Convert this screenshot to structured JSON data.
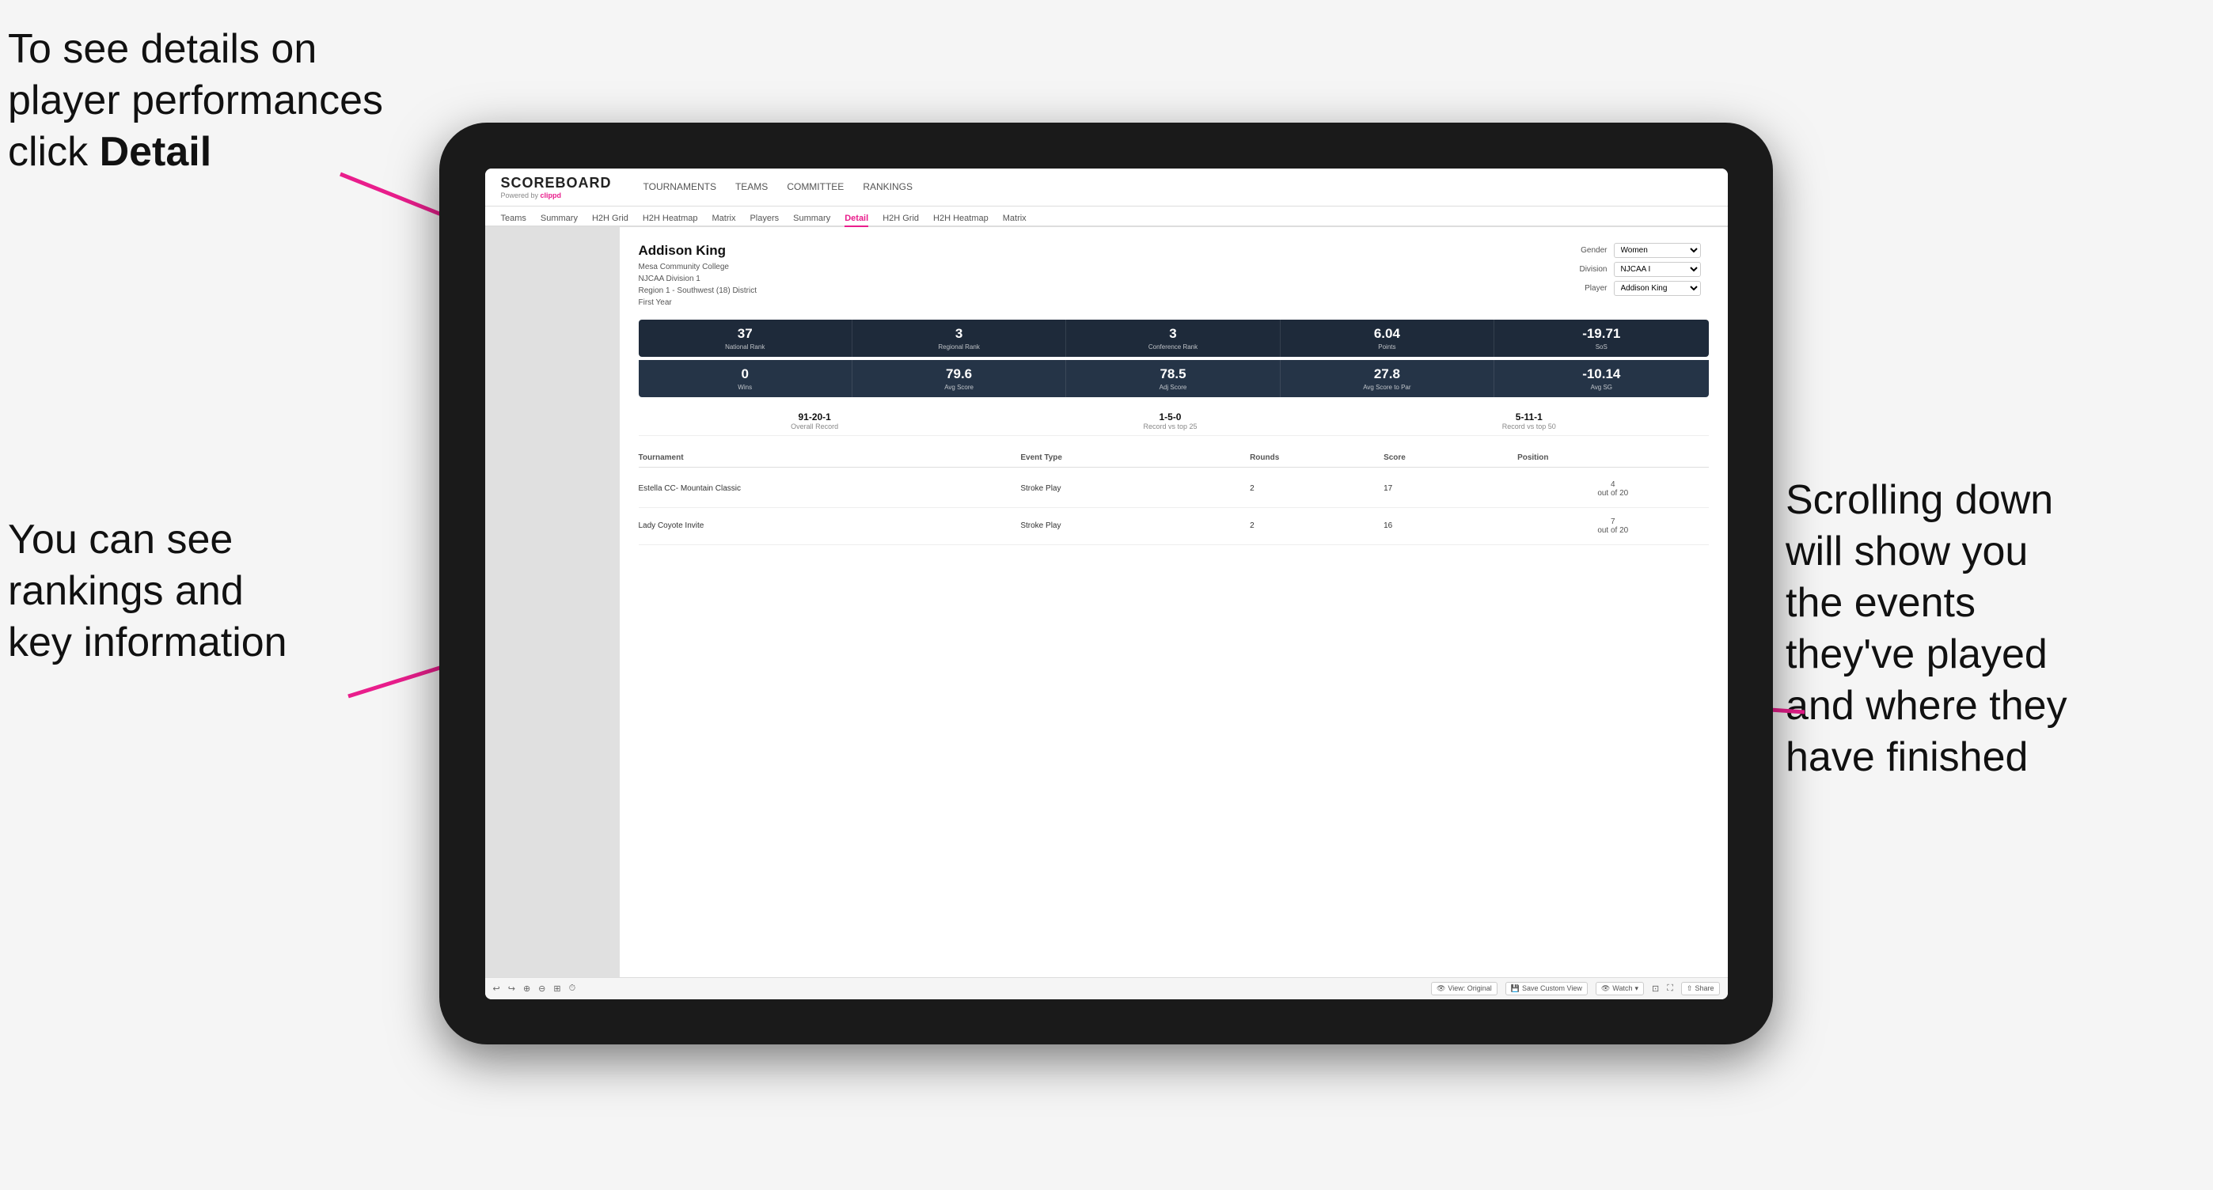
{
  "annotations": {
    "topleft": "To see details on player performances click ",
    "topleft_bold": "Detail",
    "bottomleft_line1": "You can see",
    "bottomleft_line2": "rankings and",
    "bottomleft_line3": "key information",
    "bottomright_line1": "Scrolling down",
    "bottomright_line2": "will show you",
    "bottomright_line3": "the events",
    "bottomright_line4": "they've played",
    "bottomright_line5": "and where they",
    "bottomright_line6": "have finished"
  },
  "nav": {
    "logo": "SCOREBOARD",
    "powered_by": "Powered by",
    "brand": "clippd",
    "items": [
      {
        "label": "TOURNAMENTS",
        "active": false
      },
      {
        "label": "TEAMS",
        "active": false
      },
      {
        "label": "COMMITTEE",
        "active": false
      },
      {
        "label": "RANKINGS",
        "active": false
      }
    ]
  },
  "subnav": {
    "items": [
      {
        "label": "Teams",
        "active": false
      },
      {
        "label": "Summary",
        "active": false
      },
      {
        "label": "H2H Grid",
        "active": false
      },
      {
        "label": "H2H Heatmap",
        "active": false
      },
      {
        "label": "Matrix",
        "active": false
      },
      {
        "label": "Players",
        "active": false
      },
      {
        "label": "Summary",
        "active": false
      },
      {
        "label": "Detail",
        "active": true
      },
      {
        "label": "H2H Grid",
        "active": false
      },
      {
        "label": "H2H Heatmap",
        "active": false
      },
      {
        "label": "Matrix",
        "active": false
      }
    ]
  },
  "player": {
    "name": "Addison King",
    "college": "Mesa Community College",
    "division": "NJCAA Division 1",
    "region": "Region 1 - Southwest (18) District",
    "year": "First Year"
  },
  "filters": {
    "gender_label": "Gender",
    "gender_value": "Women",
    "division_label": "Division",
    "division_value": "NJCAA I",
    "player_label": "Player",
    "player_value": "Addison King"
  },
  "stats_row1": [
    {
      "value": "37",
      "label": "National Rank"
    },
    {
      "value": "3",
      "label": "Regional Rank"
    },
    {
      "value": "3",
      "label": "Conference Rank"
    },
    {
      "value": "6.04",
      "label": "Points"
    },
    {
      "value": "-19.71",
      "label": "SoS"
    }
  ],
  "stats_row2": [
    {
      "value": "0",
      "label": "Wins"
    },
    {
      "value": "79.6",
      "label": "Avg Score"
    },
    {
      "value": "78.5",
      "label": "Adj Score"
    },
    {
      "value": "27.8",
      "label": "Avg Score to Par"
    },
    {
      "value": "-10.14",
      "label": "Avg SG"
    }
  ],
  "records": [
    {
      "value": "91-20-1",
      "label": "Overall Record"
    },
    {
      "value": "1-5-0",
      "label": "Record vs top 25"
    },
    {
      "value": "5-11-1",
      "label": "Record vs top 50"
    }
  ],
  "table": {
    "headers": [
      "Tournament",
      "Event Type",
      "Rounds",
      "Score",
      "Position"
    ],
    "rows": [
      {
        "tournament": "Estella CC- Mountain Classic",
        "event_type": "Stroke Play",
        "rounds": "2",
        "score": "17",
        "position": "4\nout of 20"
      },
      {
        "tournament": "Lady Coyote Invite",
        "event_type": "Stroke Play",
        "rounds": "2",
        "score": "16",
        "position": "7\nout of 20"
      }
    ]
  },
  "toolbar": {
    "view_original": "View: Original",
    "save_custom": "Save Custom View",
    "watch": "Watch",
    "share": "Share"
  }
}
